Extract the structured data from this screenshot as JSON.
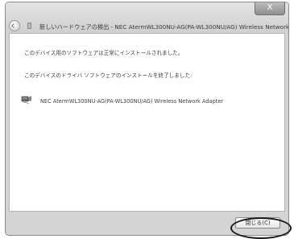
{
  "window": {
    "title": "新しいハードウェアの検出 - NEC AtermWL300NU-AG(PA-WL300NU/AG) Wireless Network",
    "close_glyph": "X"
  },
  "content": {
    "message_installed": "このデバイス用のソフトウェアは正常にインストールされました。",
    "message_finished": "このデバイスのドライバ ソフトウェアのインストールを終了しました:",
    "device_name": "NEC AtermWL300NU-AG(PA-WL300NU/AG) Wireless Network Adapter"
  },
  "footer": {
    "close_label": "閉じる(C)"
  },
  "icons": {
    "back": "back-arrow-icon",
    "title_device": "device-icon",
    "adapter": "network-adapter-icon"
  }
}
